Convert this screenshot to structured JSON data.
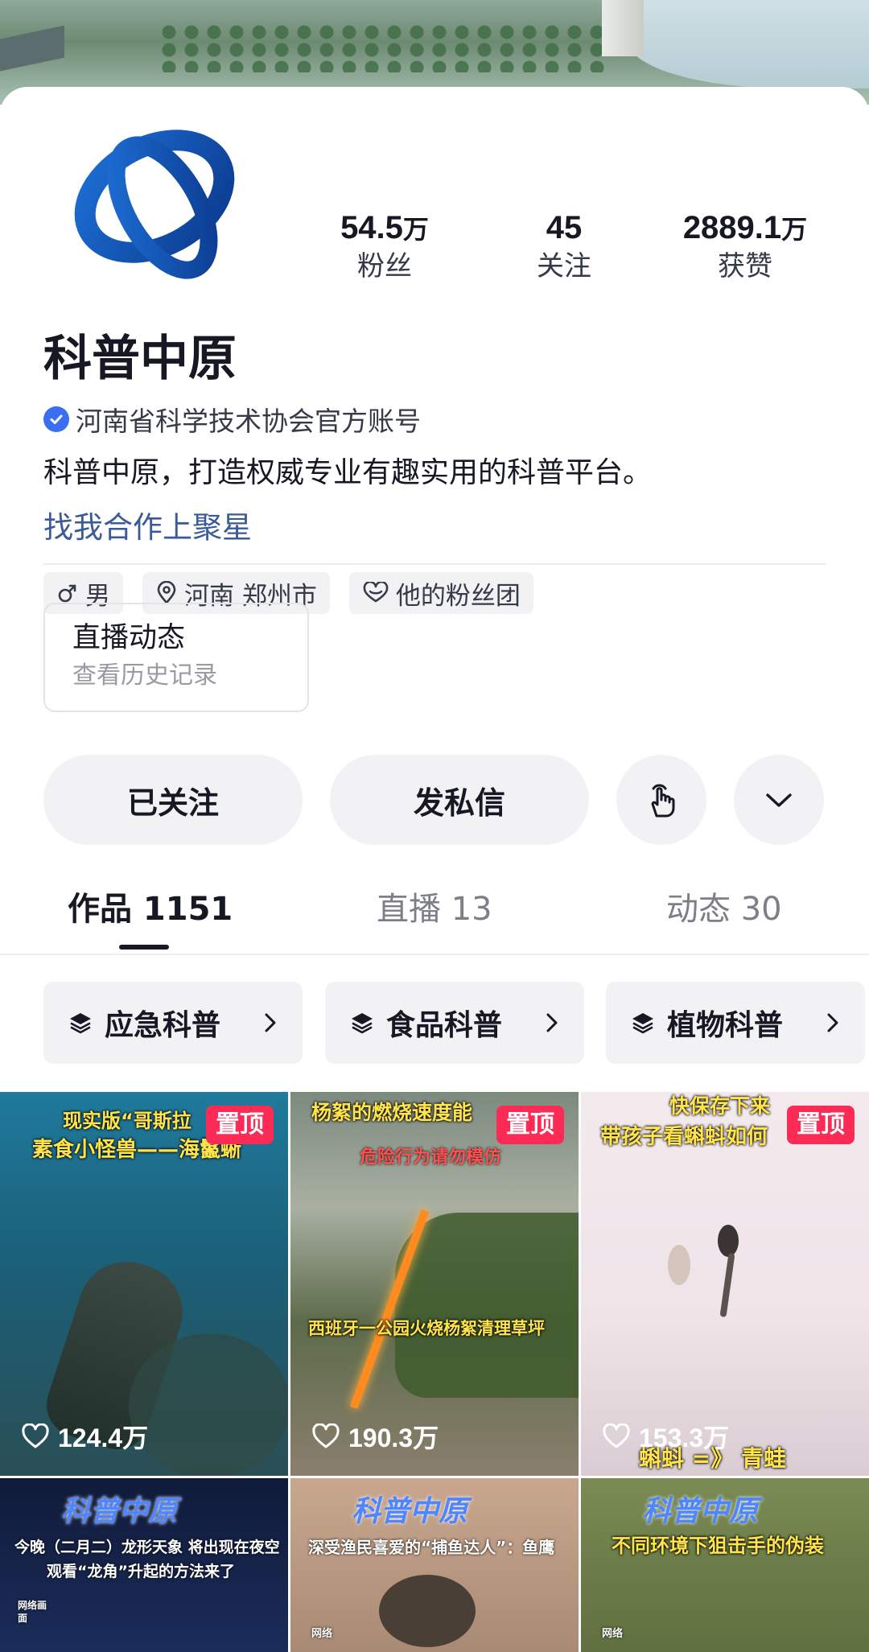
{
  "profile": {
    "name": "科普中原",
    "verify_text": "河南省科学技术协会官方账号",
    "bio": "科普中原，打造权威专业有趣实用的科普平台。",
    "link": "找我合作上聚星"
  },
  "stats": [
    {
      "num": "54.5",
      "unit": "万",
      "label": "粉丝"
    },
    {
      "num": "45",
      "unit": "",
      "label": "关注"
    },
    {
      "num": "2889.1",
      "unit": "万",
      "label": "获赞"
    }
  ],
  "tags": [
    {
      "icon": "male-icon",
      "label": "男"
    },
    {
      "icon": "location-pin-icon",
      "label": "河南 郑州市"
    },
    {
      "icon": "fan-group-heart-icon",
      "label": "他的粉丝团"
    }
  ],
  "live_card": {
    "title": "直播动态",
    "subtitle": "查看历史记录"
  },
  "actions": {
    "followed": "已关注",
    "message": "发私信",
    "poke_icon": "poke-hand-icon",
    "more_icon": "chevron-down-icon"
  },
  "tabs": [
    {
      "label": "作品 1151",
      "active": true
    },
    {
      "label": "直播 13",
      "active": false
    },
    {
      "label": "动态 30",
      "active": false
    }
  ],
  "collections": [
    "应急科普",
    "食品科普",
    "植物科普"
  ],
  "videos": [
    {
      "pin": "置顶",
      "likes": "124.4万",
      "captions": [
        "现实版“哥斯拉",
        "素食小怪兽——海鬣蜥"
      ]
    },
    {
      "pin": "置顶",
      "likes": "190.3万",
      "captions": [
        "杨絮的燃烧速度能",
        "危险行为请勿模仿",
        "西班牙一公园火烧杨絮清理草坪"
      ]
    },
    {
      "pin": "置顶",
      "likes": "153.3万",
      "captions": [
        "快保存下来",
        "带孩子看蝌蚪如何",
        "蝌蚪 =》 青蛙"
      ]
    },
    {
      "watermark": "科普中原",
      "captions": [
        "今晚（二月二）龙形天象 将出现在夜空",
        "观看“龙角”升起的方法来了",
        "网络画面"
      ]
    },
    {
      "watermark": "科普中原",
      "captions": [
        "深受渔民喜爱的“捕鱼达人”：鱼鹰",
        "网络"
      ]
    },
    {
      "watermark": "科普中原",
      "captions": [
        "不同环境下狙击手的伪装",
        "网络"
      ]
    }
  ],
  "colors": {
    "accent_pin": "#fc2b55",
    "link": "#3a5a98",
    "verify": "#3b6ff2"
  }
}
